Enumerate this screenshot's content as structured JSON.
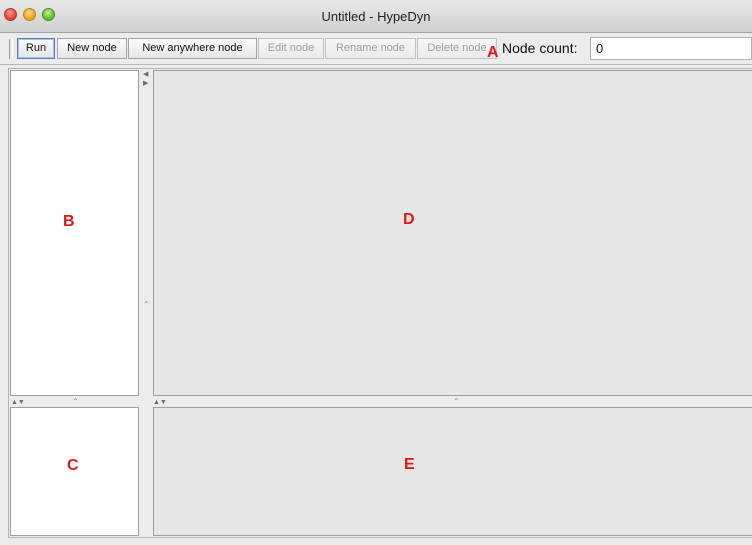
{
  "window": {
    "title": "Untitled - HypeDyn"
  },
  "toolbar": {
    "buttons": [
      {
        "label": "Run",
        "enabled": true
      },
      {
        "label": "New node",
        "enabled": true
      },
      {
        "label": "New anywhere node",
        "enabled": true
      },
      {
        "label": "Edit node",
        "enabled": false
      },
      {
        "label": "Rename node",
        "enabled": false
      },
      {
        "label": "Delete node",
        "enabled": false
      }
    ],
    "node_count_label": "Node count:",
    "node_count_value": "0"
  },
  "annotations": {
    "a": "A",
    "b": "B",
    "c": "C",
    "d": "D",
    "e": "E"
  },
  "colors": {
    "annotation": "#e01818"
  }
}
